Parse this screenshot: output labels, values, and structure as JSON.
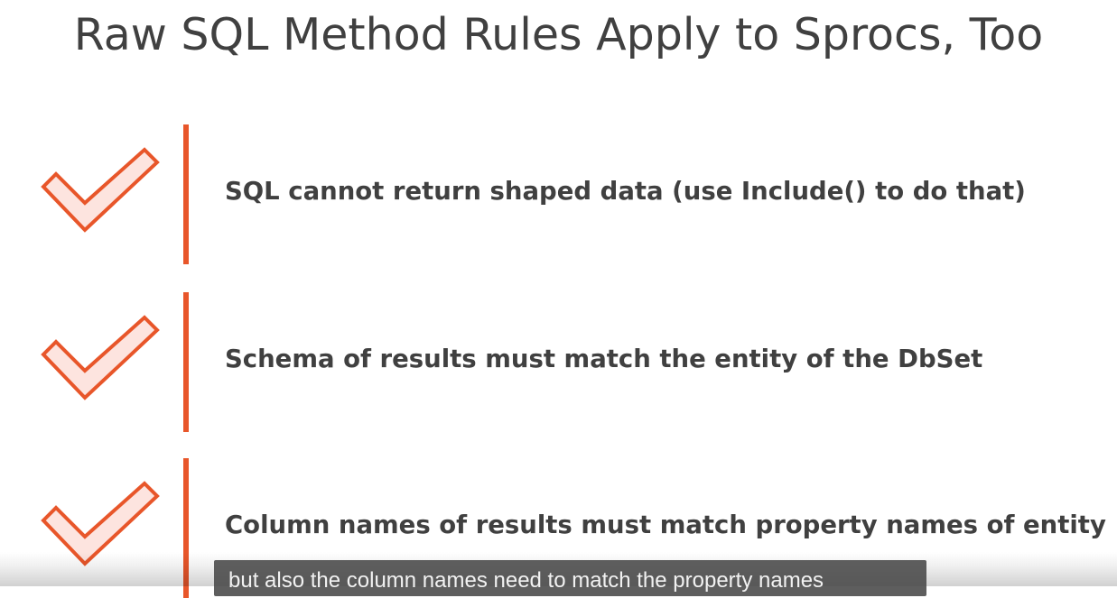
{
  "slide": {
    "title": "Raw SQL Method Rules Apply to Sprocs, Too",
    "bullets": [
      {
        "icon": "checkmark-icon",
        "text": "SQL cannot return shaped data (use Include() to do that)"
      },
      {
        "icon": "checkmark-icon",
        "text": "Schema of results must match the entity of the DbSet"
      },
      {
        "icon": "checkmark-icon",
        "text": "Column names of results must match property names of entity"
      }
    ]
  },
  "caption": {
    "text": "but also the column names need to match the property names"
  },
  "colors": {
    "accent": "#e8562a",
    "check_fill": "#fde4df",
    "text": "#404040",
    "caption_bg": "#484848",
    "caption_text": "#f2f2f2"
  }
}
